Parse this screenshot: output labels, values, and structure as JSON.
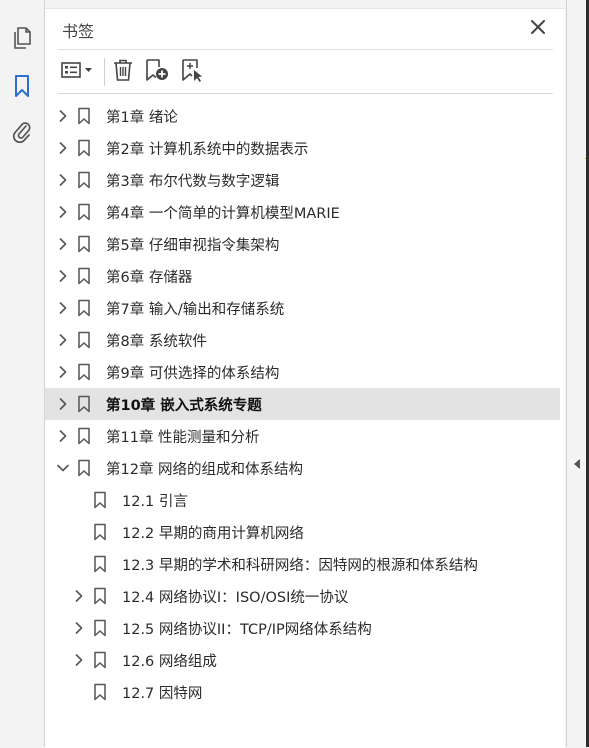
{
  "left_toolbar": {
    "icons": [
      "pages-icon",
      "bookmark-icon",
      "attachment-icon"
    ],
    "active": "bookmark-icon",
    "accent": "#2b6fcf"
  },
  "panel": {
    "title": "书签",
    "close_icon": "close-icon",
    "toolbar_icons": [
      "options-icon",
      "delete-icon",
      "new-bookmark-icon",
      "bookmark-from-selection-icon"
    ]
  },
  "bookmarks": [
    {
      "label": "第1章 绪论",
      "level": 0,
      "expander": "collapsed"
    },
    {
      "label": "第2章 计算机系统中的数据表示",
      "level": 0,
      "expander": "collapsed"
    },
    {
      "label": "第3章 布尔代数与数字逻辑",
      "level": 0,
      "expander": "collapsed"
    },
    {
      "label": "第4章 一个简单的计算机模型MARIE",
      "level": 0,
      "expander": "collapsed"
    },
    {
      "label": "第5章 仔细审视指令集架构",
      "level": 0,
      "expander": "collapsed"
    },
    {
      "label": "第6章 存储器",
      "level": 0,
      "expander": "collapsed"
    },
    {
      "label": "第7章 输入/输出和存储系统",
      "level": 0,
      "expander": "collapsed"
    },
    {
      "label": "第8章 系统软件",
      "level": 0,
      "expander": "collapsed"
    },
    {
      "label": "第9章 可供选择的体系结构",
      "level": 0,
      "expander": "collapsed"
    },
    {
      "label": "第10章 嵌入式系统专题",
      "level": 0,
      "expander": "collapsed",
      "selected": true
    },
    {
      "label": "第11章 性能测量和分析",
      "level": 0,
      "expander": "collapsed"
    },
    {
      "label": "第12章 网络的组成和体系结构",
      "level": 0,
      "expander": "expanded"
    },
    {
      "label": "12.1 引言",
      "level": 1,
      "expander": "none"
    },
    {
      "label": "12.2 早期的商用计算机网络",
      "level": 1,
      "expander": "none"
    },
    {
      "label": "12.3 早期的学术和科研网络：因特网的根源和体系结构",
      "level": 1,
      "expander": "none"
    },
    {
      "label": "12.4 网络协议I：ISO/OSI统一协议",
      "level": 1,
      "expander": "collapsed"
    },
    {
      "label": "12.5 网络协议II：TCP/IP网络体系结构",
      "level": 1,
      "expander": "collapsed"
    },
    {
      "label": "12.6 网络组成",
      "level": 1,
      "expander": "collapsed"
    },
    {
      "label": "12.7 因特网",
      "level": 1,
      "expander": "none"
    }
  ],
  "right_rail": {
    "collapse_icon": "collapse-left-arrow-icon"
  }
}
